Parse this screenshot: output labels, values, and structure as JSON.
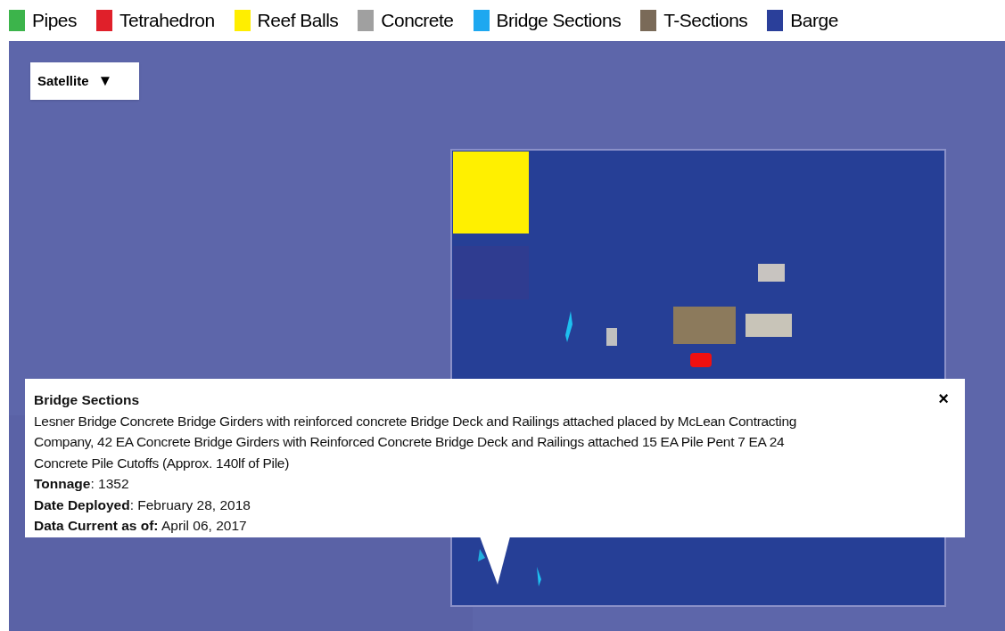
{
  "legend": [
    {
      "label": "Pipes",
      "color": "#3cb44b"
    },
    {
      "label": "Tetrahedron",
      "color": "#e0202a"
    },
    {
      "label": "Reef Balls",
      "color": "#ffee00"
    },
    {
      "label": "Concrete",
      "color": "#a0a0a0"
    },
    {
      "label": "Bridge Sections",
      "color": "#1ea8f0"
    },
    {
      "label": "T-Sections",
      "color": "#7a6a58"
    },
    {
      "label": "Barge",
      "color": "#2a3f9a"
    }
  ],
  "map": {
    "kind": "picture",
    "map_type_button": {
      "label": "Satellite",
      "caret": "▼"
    }
  },
  "popup": {
    "title": "Bridge Sections",
    "close": "×",
    "description": "Lesner Bridge Concrete Bridge Girders with reinforced concrete Bridge Deck and Railings attached placed by McLean Contracting Company, 42 EA Concrete Bridge Girders with Reinforced Concrete Bridge Deck and Railings attached 15 EA Pile Pent 7 EA 24 Concrete Pile Cutoffs (Approx. 140lf of Pile)",
    "fields": [
      "**Tonnage**: 1352",
      "**Date Deployed**: February 28, 2018",
      "**Data Current as of:** April 06, 2017"
    ]
  }
}
